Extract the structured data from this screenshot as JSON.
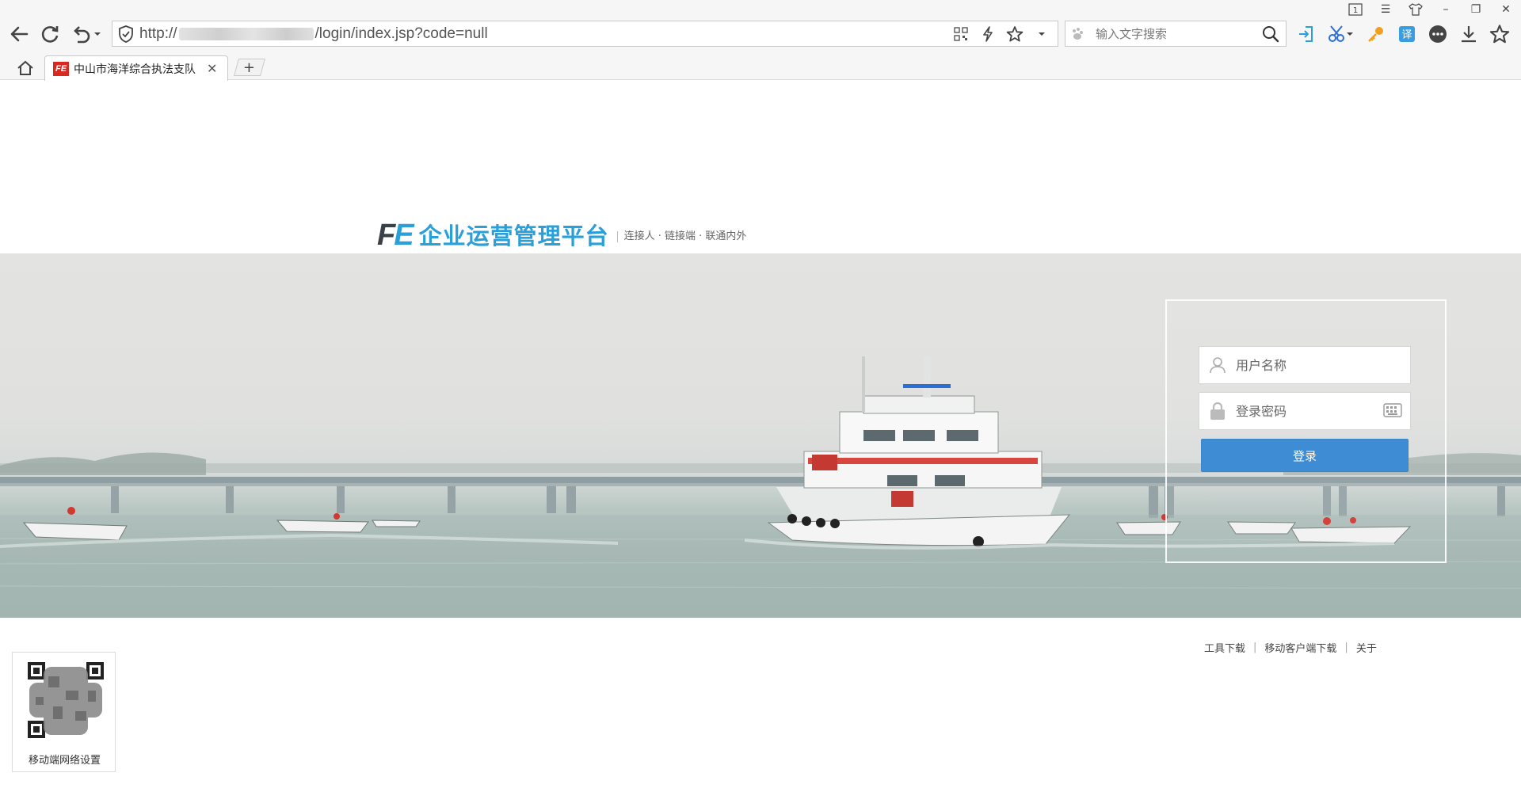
{
  "browser": {
    "url_prefix": "http://",
    "url_suffix": "/login/index.jsp?code=null",
    "search_placeholder": "输入文字搜索",
    "tab_title": "中山市海洋综合执法支队",
    "tab_favicon_text": "FE",
    "new_tab_label": "+",
    "window_badge": "1"
  },
  "header": {
    "logo_mark_f": "F",
    "logo_mark_e": "E",
    "title": "企业运营管理平台",
    "slogan": "连接人 · 链接端 · 联通内外"
  },
  "login": {
    "username_placeholder": "用户名称",
    "password_placeholder": "登录密码",
    "submit_label": "登录"
  },
  "footer": {
    "links": [
      "工具下载",
      "移动客户端下载",
      "关于"
    ],
    "qr_label": "移动端网络设置"
  },
  "colors": {
    "brand_blue": "#2a9fd8",
    "button_blue": "#3e8dd4",
    "favicon_red": "#d8281f"
  }
}
